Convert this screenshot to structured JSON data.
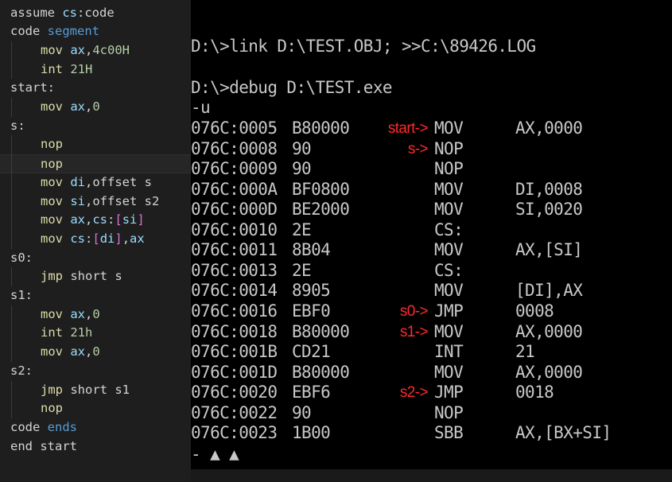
{
  "colors": {
    "editor_bg": "#1e1e1e",
    "plain": "#d4d4d4",
    "keyword": "#569cd6",
    "register": "#9cdcfe",
    "number": "#b5cea8",
    "bracket": "#da70d6",
    "mnemonic": "#dcdcaa",
    "terminal_bg": "#000000",
    "terminal_text": "#c8c8c8",
    "annotation": "#ff2a2a"
  },
  "editor": {
    "lines": [
      {
        "indent": false,
        "tokens": [
          {
            "t": "assume ",
            "c": "plain"
          },
          {
            "t": "cs",
            "c": "register"
          },
          {
            "t": ":code",
            "c": "plain"
          }
        ]
      },
      {
        "indent": false,
        "tokens": [
          {
            "t": "code ",
            "c": "plain"
          },
          {
            "t": "segment",
            "c": "keyword"
          }
        ]
      },
      {
        "indent": true,
        "tokens": [
          {
            "t": "mov ",
            "c": "mnemonic"
          },
          {
            "t": "ax",
            "c": "register"
          },
          {
            "t": ",",
            "c": "plain"
          },
          {
            "t": "4c00H",
            "c": "number"
          }
        ]
      },
      {
        "indent": true,
        "tokens": [
          {
            "t": "int ",
            "c": "mnemonic"
          },
          {
            "t": "21H",
            "c": "number"
          }
        ]
      },
      {
        "indent": false,
        "tokens": [
          {
            "t": "start:",
            "c": "plain"
          }
        ]
      },
      {
        "indent": true,
        "tokens": [
          {
            "t": "mov ",
            "c": "mnemonic"
          },
          {
            "t": "ax",
            "c": "register"
          },
          {
            "t": ",",
            "c": "plain"
          },
          {
            "t": "0",
            "c": "number"
          }
        ]
      },
      {
        "indent": false,
        "tokens": [
          {
            "t": "s:",
            "c": "plain"
          }
        ]
      },
      {
        "indent": true,
        "tokens": [
          {
            "t": "nop",
            "c": "mnemonic"
          }
        ]
      },
      {
        "indent": true,
        "highlight": true,
        "tokens": [
          {
            "t": "nop",
            "c": "mnemonic"
          }
        ]
      },
      {
        "indent": true,
        "tokens": [
          {
            "t": "mov ",
            "c": "mnemonic"
          },
          {
            "t": "di",
            "c": "register"
          },
          {
            "t": ",offset s",
            "c": "plain"
          }
        ]
      },
      {
        "indent": true,
        "tokens": [
          {
            "t": "mov ",
            "c": "mnemonic"
          },
          {
            "t": "si",
            "c": "register"
          },
          {
            "t": ",offset s2",
            "c": "plain"
          }
        ]
      },
      {
        "indent": true,
        "tokens": [
          {
            "t": "mov ",
            "c": "mnemonic"
          },
          {
            "t": "ax",
            "c": "register"
          },
          {
            "t": ",",
            "c": "plain"
          },
          {
            "t": "cs",
            "c": "register"
          },
          {
            "t": ":",
            "c": "plain"
          },
          {
            "t": "[",
            "c": "bracket"
          },
          {
            "t": "si",
            "c": "register"
          },
          {
            "t": "]",
            "c": "bracket"
          }
        ]
      },
      {
        "indent": true,
        "tokens": [
          {
            "t": "mov ",
            "c": "mnemonic"
          },
          {
            "t": "cs",
            "c": "register"
          },
          {
            "t": ":",
            "c": "plain"
          },
          {
            "t": "[",
            "c": "bracket"
          },
          {
            "t": "di",
            "c": "register"
          },
          {
            "t": "]",
            "c": "bracket"
          },
          {
            "t": ",",
            "c": "plain"
          },
          {
            "t": "ax",
            "c": "register"
          }
        ]
      },
      {
        "indent": false,
        "tokens": [
          {
            "t": "s0:",
            "c": "plain"
          }
        ]
      },
      {
        "indent": true,
        "tokens": [
          {
            "t": "jmp ",
            "c": "mnemonic"
          },
          {
            "t": "short s",
            "c": "plain"
          }
        ]
      },
      {
        "indent": false,
        "tokens": [
          {
            "t": "s1:",
            "c": "plain"
          }
        ]
      },
      {
        "indent": true,
        "tokens": [
          {
            "t": "mov ",
            "c": "mnemonic"
          },
          {
            "t": "ax",
            "c": "register"
          },
          {
            "t": ",",
            "c": "plain"
          },
          {
            "t": "0",
            "c": "number"
          }
        ]
      },
      {
        "indent": true,
        "tokens": [
          {
            "t": "int ",
            "c": "mnemonic"
          },
          {
            "t": "21h",
            "c": "number"
          }
        ]
      },
      {
        "indent": true,
        "tokens": [
          {
            "t": "mov ",
            "c": "mnemonic"
          },
          {
            "t": "ax",
            "c": "register"
          },
          {
            "t": ",",
            "c": "plain"
          },
          {
            "t": "0",
            "c": "number"
          }
        ]
      },
      {
        "indent": false,
        "tokens": [
          {
            "t": "s2:",
            "c": "plain"
          }
        ]
      },
      {
        "indent": true,
        "tokens": [
          {
            "t": "jmp ",
            "c": "mnemonic"
          },
          {
            "t": "short s1",
            "c": "plain"
          }
        ]
      },
      {
        "indent": true,
        "tokens": [
          {
            "t": "nop",
            "c": "mnemonic"
          }
        ]
      },
      {
        "indent": false,
        "tokens": [
          {
            "t": "code ",
            "c": "plain"
          },
          {
            "t": "ends",
            "c": "keyword"
          }
        ]
      },
      {
        "indent": false,
        "tokens": [
          {
            "t": "end start",
            "c": "plain"
          }
        ]
      }
    ]
  },
  "terminal": {
    "link_cmd": "D:\\>link D:\\TEST.OBJ; >>C:\\89426.LOG",
    "debug_cmd": "D:\\>debug D:\\TEST.exe",
    "u_cmd": "-u",
    "rows": [
      {
        "addr": "076C:0005",
        "bytes": "B80000",
        "mnemonic": "MOV",
        "operands": "AX,0000",
        "annotation": "start->"
      },
      {
        "addr": "076C:0008",
        "bytes": "90",
        "mnemonic": "NOP",
        "operands": "",
        "annotation": "s->"
      },
      {
        "addr": "076C:0009",
        "bytes": "90",
        "mnemonic": "NOP",
        "operands": "",
        "annotation": ""
      },
      {
        "addr": "076C:000A",
        "bytes": "BF0800",
        "mnemonic": "MOV",
        "operands": "DI,0008",
        "annotation": ""
      },
      {
        "addr": "076C:000D",
        "bytes": "BE2000",
        "mnemonic": "MOV",
        "operands": "SI,0020",
        "annotation": ""
      },
      {
        "addr": "076C:0010",
        "bytes": "2E",
        "mnemonic": "CS:",
        "operands": "",
        "annotation": ""
      },
      {
        "addr": "076C:0011",
        "bytes": "8B04",
        "mnemonic": "MOV",
        "operands": "AX,[SI]",
        "annotation": ""
      },
      {
        "addr": "076C:0013",
        "bytes": "2E",
        "mnemonic": "CS:",
        "operands": "",
        "annotation": ""
      },
      {
        "addr": "076C:0014",
        "bytes": "8905",
        "mnemonic": "MOV",
        "operands": "[DI],AX",
        "annotation": ""
      },
      {
        "addr": "076C:0016",
        "bytes": "EBF0",
        "mnemonic": "JMP",
        "operands": "0008",
        "annotation": "s0->"
      },
      {
        "addr": "076C:0018",
        "bytes": "B80000",
        "mnemonic": "MOV",
        "operands": "AX,0000",
        "annotation": "s1->"
      },
      {
        "addr": "076C:001B",
        "bytes": "CD21",
        "mnemonic": "INT",
        "operands": "21",
        "annotation": ""
      },
      {
        "addr": "076C:001D",
        "bytes": "B80000",
        "mnemonic": "MOV",
        "operands": "AX,0000",
        "annotation": ""
      },
      {
        "addr": "076C:0020",
        "bytes": "EBF6",
        "mnemonic": "JMP",
        "operands": "0018",
        "annotation": "s2->"
      },
      {
        "addr": "076C:0022",
        "bytes": "90",
        "mnemonic": "NOP",
        "operands": "",
        "annotation": ""
      },
      {
        "addr": "076C:0023",
        "bytes": "1B00",
        "mnemonic": "SBB",
        "operands": "AX,[BX+SI]",
        "annotation": ""
      }
    ],
    "partial_last": "- ▲ ▲"
  }
}
